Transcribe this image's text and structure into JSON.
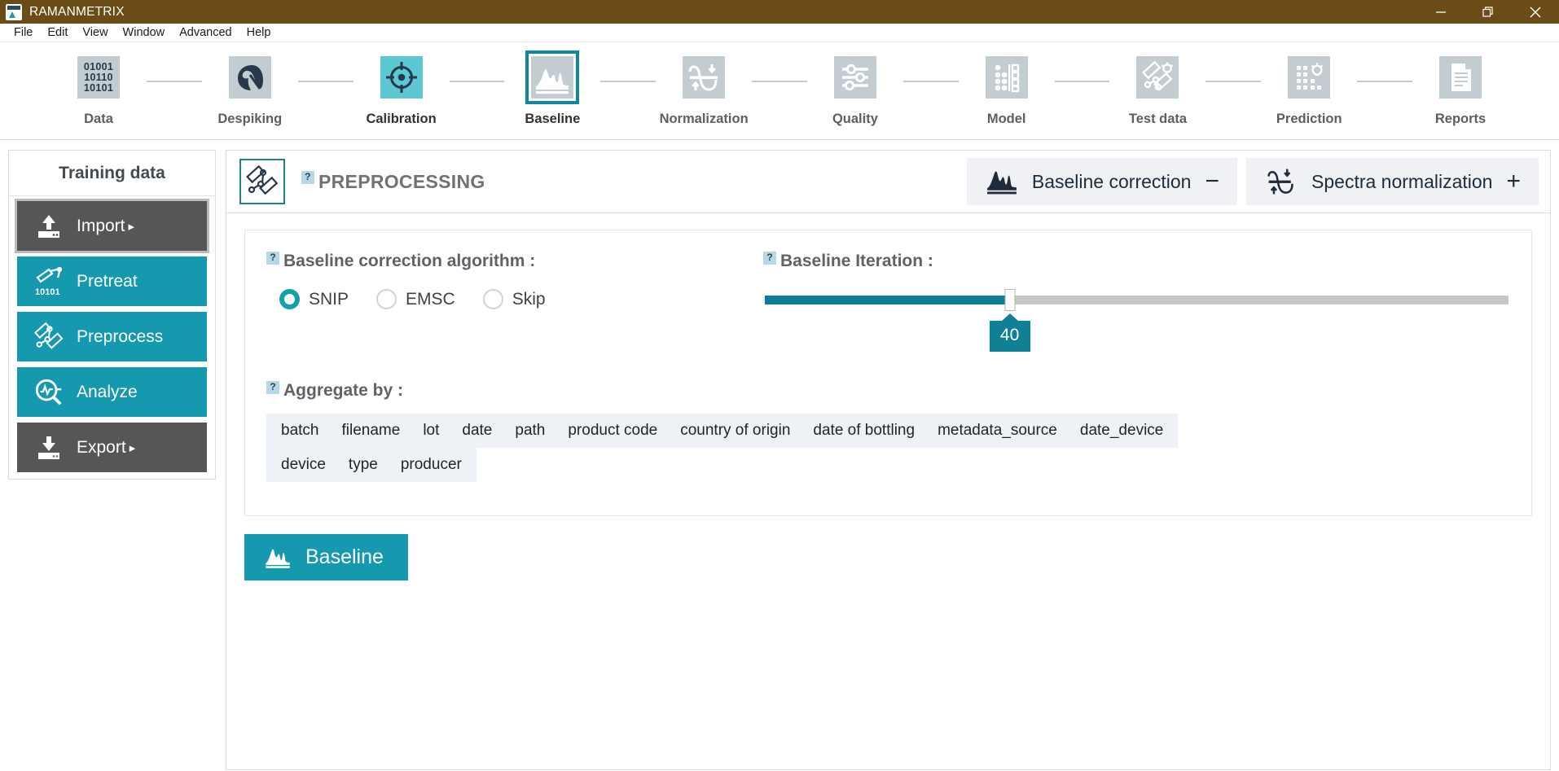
{
  "window": {
    "title": "RAMANMETRIX",
    "titlebar_color": "#6b4c17",
    "accent_color": "#1499ae",
    "controls": {
      "minimize": "minimize-button",
      "maximize": "maximize-button",
      "close": "close-button"
    }
  },
  "menubar": {
    "items": [
      {
        "label": "File"
      },
      {
        "label": "Edit"
      },
      {
        "label": "View"
      },
      {
        "label": "Window"
      },
      {
        "label": "Advanced"
      },
      {
        "label": "Help"
      }
    ]
  },
  "workflow": {
    "steps": [
      {
        "label": "Data",
        "icon": "binary-data-icon",
        "state": "done"
      },
      {
        "label": "Despiking",
        "icon": "despiking-icon",
        "state": "done"
      },
      {
        "label": "Calibration",
        "icon": "target-icon",
        "state": "complete"
      },
      {
        "label": "Baseline",
        "icon": "spectrum-icon",
        "state": "active"
      },
      {
        "label": "Normalization",
        "icon": "normalization-icon",
        "state": "todo"
      },
      {
        "label": "Quality",
        "icon": "sliders-icon",
        "state": "todo"
      },
      {
        "label": "Model",
        "icon": "model-matrix-icon",
        "state": "todo"
      },
      {
        "label": "Test data",
        "icon": "test-data-icon",
        "state": "todo"
      },
      {
        "label": "Prediction",
        "icon": "prediction-icon",
        "state": "todo"
      },
      {
        "label": "Reports",
        "icon": "report-icon",
        "state": "todo"
      }
    ]
  },
  "sidebar": {
    "title": "Training data",
    "items": [
      {
        "label": "Import",
        "icon": "upload-icon",
        "caret": "▸",
        "style": "gray",
        "selected": true
      },
      {
        "label": "Pretreat",
        "icon": "pretreat-icon",
        "caret": "",
        "style": "teal",
        "selected": false
      },
      {
        "label": "Preprocess",
        "icon": "preprocess-icon",
        "caret": "",
        "style": "teal",
        "selected": false
      },
      {
        "label": "Analyze",
        "icon": "analyze-icon",
        "caret": "",
        "style": "teal",
        "selected": false
      },
      {
        "label": "Export",
        "icon": "download-icon",
        "caret": "▸",
        "style": "gray",
        "selected": false
      }
    ]
  },
  "panel": {
    "icon": "preprocess-icon",
    "help": "?",
    "title": "PREPROCESSING",
    "tabs": [
      {
        "label": "Baseline correction",
        "icon": "spectrum-icon",
        "sign": "−",
        "expanded": true
      },
      {
        "label": "Spectra normalization",
        "icon": "normalization-icon",
        "sign": "+",
        "expanded": false
      }
    ]
  },
  "settings": {
    "algorithm": {
      "help": "?",
      "label": "Baseline correction algorithm :",
      "options": [
        {
          "label": "SNIP",
          "selected": true
        },
        {
          "label": "EMSC",
          "selected": false
        },
        {
          "label": "Skip",
          "selected": false
        }
      ]
    },
    "iteration": {
      "help": "?",
      "label": "Baseline Iteration :",
      "value": "40",
      "percent": 33
    },
    "aggregate": {
      "help": "?",
      "label": "Aggregate by :",
      "rows": [
        [
          "batch",
          "filename",
          "lot",
          "date",
          "path",
          "product code",
          "country of origin",
          "date of bottling",
          "metadata_source",
          "date_device"
        ],
        [
          "device",
          "type",
          "producer"
        ]
      ]
    }
  },
  "actions": {
    "run": {
      "label": "Baseline",
      "icon": "spectrum-icon"
    }
  }
}
